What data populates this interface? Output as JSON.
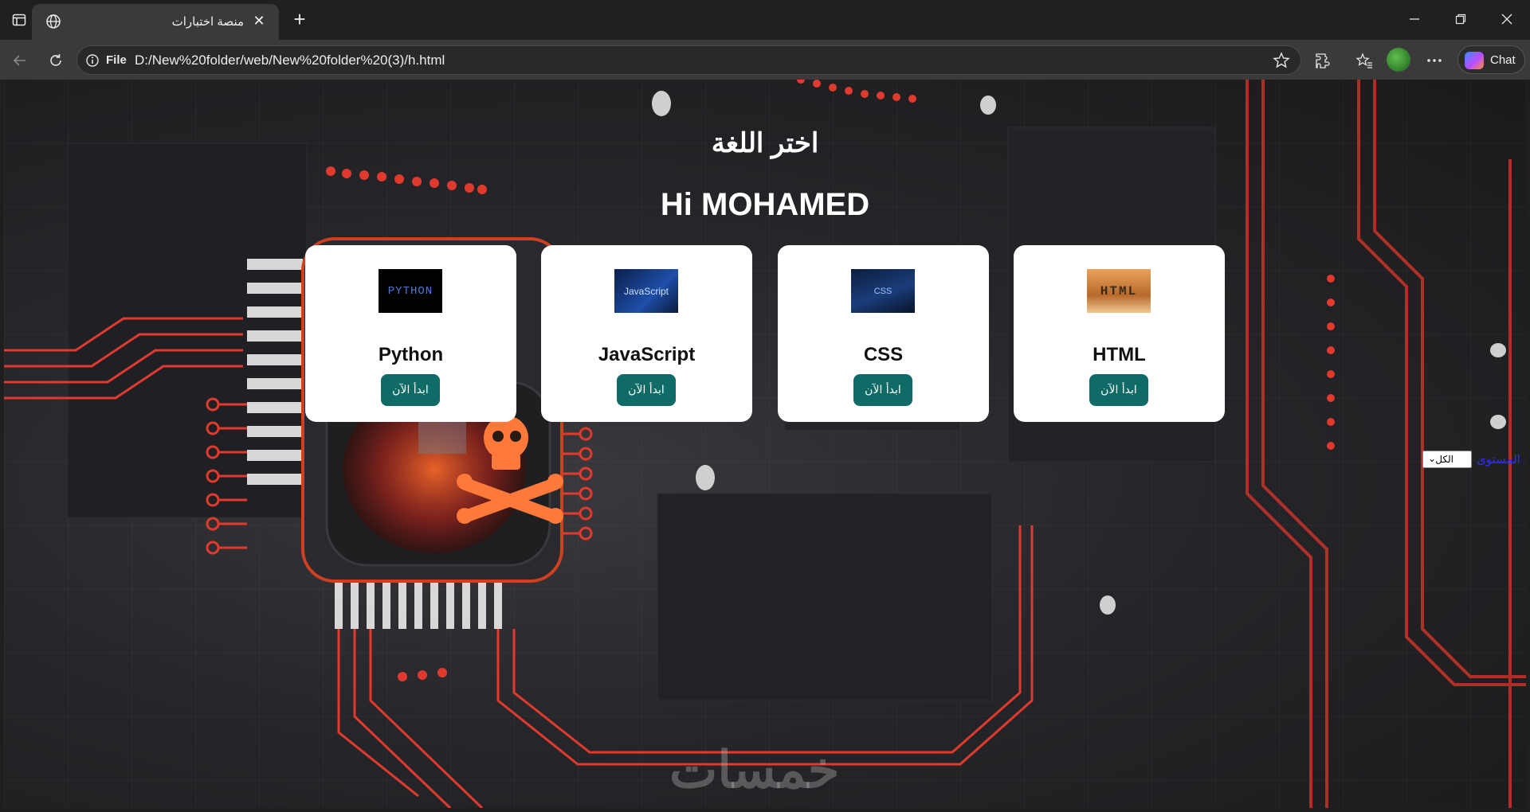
{
  "browser": {
    "tab_title": "منصة اختبارات",
    "url_scheme": "File",
    "url": "D:/New%20folder/web/New%20folder%20(3)/h.html",
    "chat_label": "Chat"
  },
  "page": {
    "heading": "اختر اللغة",
    "greeting": "Hi MOHAMED",
    "cards": [
      {
        "name": "Python",
        "thumb_text": "PYTHON",
        "button": "ابدأ الآن"
      },
      {
        "name": "JavaScript",
        "thumb_text": "JavaScript",
        "button": "ابدأ الآن"
      },
      {
        "name": "CSS",
        "thumb_text": "CSS",
        "button": "ابدأ الآن"
      },
      {
        "name": "HTML",
        "thumb_text": "HTML",
        "button": "ابدأ الآن"
      }
    ],
    "level_label": "المستوى",
    "level_value": "الكل",
    "watermark": "خمسات"
  },
  "colors": {
    "accent_button": "#0e6b66",
    "circuit_red": "#e03a2e"
  }
}
